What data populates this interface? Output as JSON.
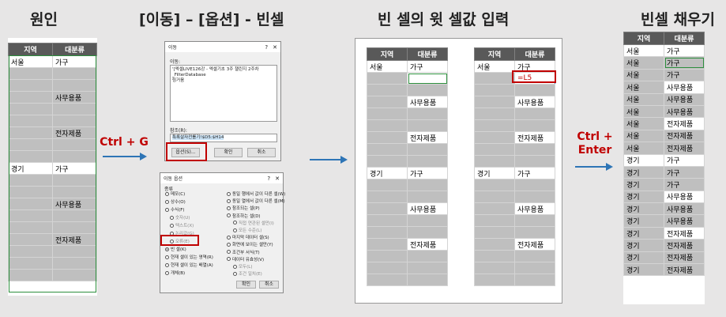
{
  "titles": {
    "original": "원인",
    "goto_options": "[이동] – [옵션] - 빈셀",
    "enter_above": "빈 셀의 윗 셀값 입력",
    "fill_blank": "빈셀 채우기"
  },
  "keys": {
    "ctrl_g": "Ctrl + G",
    "ctrl_enter_1": "Ctrl +",
    "ctrl_enter_2": "Enter"
  },
  "headers": {
    "region": "지역",
    "category": "대분류"
  },
  "values": {
    "seoul": "서울",
    "gyeonggi": "경기",
    "furniture": "가구",
    "office": "사무용품",
    "electronics": "전자제품",
    "formula": "=L5"
  },
  "goto_dialog": {
    "title": "이동",
    "help": "?",
    "close": "✕",
    "goto_label": "이동:",
    "list_lines": [
      "'[엑셀LIVE126강 - 엑셀기초 3주 챌린지 2주차",
      "_FilterDatabase",
      "링거움"
    ],
    "reference_label": "참조(R):",
    "reference_value": "특록살자전롤기!$D5:$H14",
    "options_button": "옵션(S)...",
    "ok_button": "확인",
    "cancel_button": "취소"
  },
  "options_dialog": {
    "title": "이동 옵션",
    "help": "?",
    "close": "✕",
    "group_label": "종류",
    "left_options": [
      "메모(C)",
      "상수(O)",
      "수식(F)",
      "숫자(U)",
      "텍스트(X)",
      "논리값(G)",
      "오류(E)",
      "빈 셀(K)",
      "현재 셀이 있는 영역(R)",
      "현재 셀이 있는 배열(A)",
      "개체(B)"
    ],
    "right_options": [
      "동일 행에서 값이 다른 셀(W)",
      "동일 열에서 값이 다른 셀(M)",
      "참조되는 셀(P)",
      "참조하는 셀(D)",
      "직접 연관된 셀만(I)",
      "모든 수준(L)",
      "마지막 데이터 셀(S)",
      "화면에 보이는 셀만(Y)",
      "조건부 서식(T)",
      "데이터 유효성(V)",
      "모두(L)",
      "조건 일치(E)"
    ],
    "ok_button": "확인",
    "cancel_button": "취소"
  }
}
